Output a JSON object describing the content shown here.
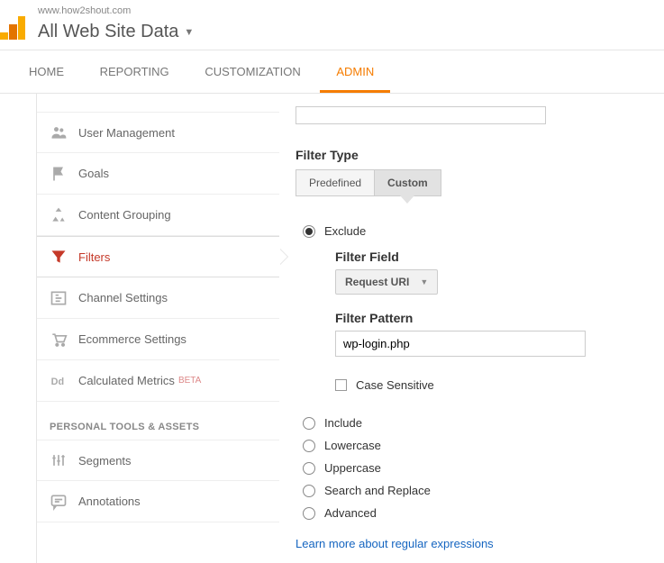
{
  "header": {
    "host": "www.how2shout.com",
    "property_title": "All Web Site Data"
  },
  "tabs": [
    "HOME",
    "REPORTING",
    "CUSTOMIZATION",
    "ADMIN"
  ],
  "active_tab": 3,
  "sidebar": {
    "items": [
      {
        "label": "User Management",
        "icon": "users"
      },
      {
        "label": "Goals",
        "icon": "flag"
      },
      {
        "label": "Content Grouping",
        "icon": "group"
      },
      {
        "label": "Filters",
        "icon": "funnel",
        "active": true
      },
      {
        "label": "Channel Settings",
        "icon": "channel"
      },
      {
        "label": "Ecommerce Settings",
        "icon": "cart"
      },
      {
        "label": "Calculated Metrics",
        "icon": "dd",
        "beta": "BETA"
      }
    ],
    "section_head": "PERSONAL TOOLS & ASSETS",
    "extra": [
      {
        "label": "Segments",
        "icon": "segments"
      },
      {
        "label": "Annotations",
        "icon": "annot"
      }
    ]
  },
  "filter": {
    "type_label": "Filter Type",
    "seg_predefined": "Predefined",
    "seg_custom": "Custom",
    "radios": {
      "exclude": "Exclude",
      "include": "Include",
      "lowercase": "Lowercase",
      "uppercase": "Uppercase",
      "search_replace": "Search and Replace",
      "advanced": "Advanced"
    },
    "field_label": "Filter Field",
    "field_value": "Request URI",
    "pattern_label": "Filter Pattern",
    "pattern_value": "wp-login.php",
    "case_sensitive": "Case Sensitive",
    "learn_link": "Learn more about regular expressions"
  }
}
